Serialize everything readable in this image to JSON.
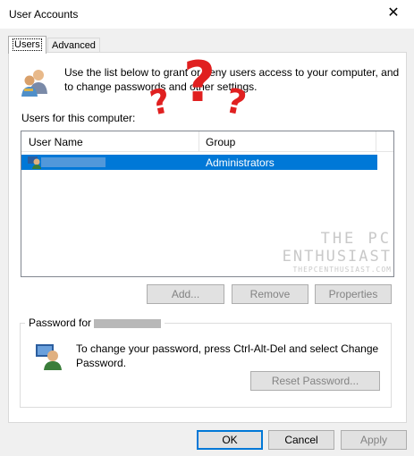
{
  "window": {
    "title": "User Accounts",
    "close_glyph": "✕"
  },
  "tabs": [
    {
      "label": "Users"
    },
    {
      "label": "Advanced"
    }
  ],
  "intro": {
    "text": "Use the list below to grant or deny users access to your computer, and to change passwords and other settings."
  },
  "users": {
    "label": "Users for this computer:",
    "columns": [
      "User Name",
      "Group"
    ],
    "rows": [
      {
        "group": "Administrators"
      }
    ]
  },
  "list_buttons": {
    "add": "Add...",
    "remove": "Remove",
    "properties": "Properties"
  },
  "password": {
    "legend_prefix": "Password for",
    "text": "To change your password, press Ctrl-Alt-Del and select Change Password.",
    "reset_label": "Reset Password..."
  },
  "watermark": {
    "line1": "THE PC",
    "line2": "ENTHUSIAST",
    "line3": "THEPCENTHUSIAST.COM"
  },
  "overlay": {
    "marks": [
      "?",
      "?",
      "?"
    ],
    "color": "#e02020"
  },
  "dialog_buttons": {
    "ok": "OK",
    "cancel": "Cancel",
    "apply": "Apply"
  },
  "colors": {
    "selection": "#0078d7",
    "default_button_border": "#0078d7"
  }
}
